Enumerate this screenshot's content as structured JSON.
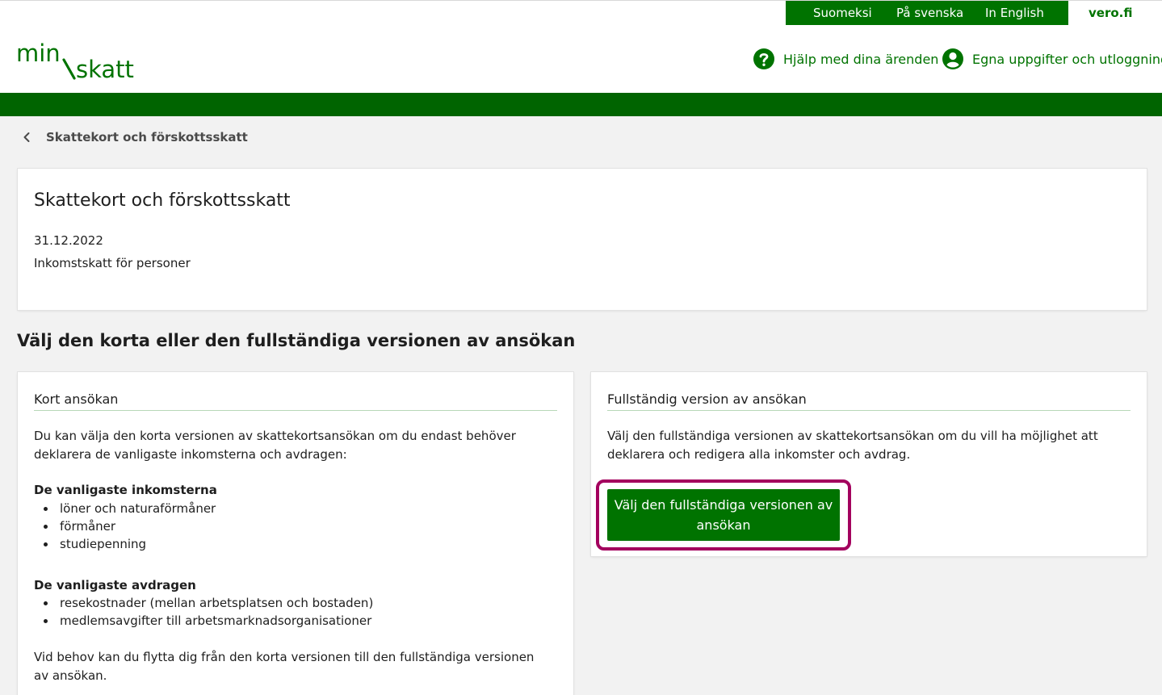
{
  "header": {
    "languages": [
      "Suomeksi",
      "På svenska",
      "In English"
    ],
    "vero_link": "vero.fi",
    "logo_text": "min/skatt",
    "help_link": "Hjälp med dina ärenden",
    "profile_link": "Egna uppgifter och utloggning"
  },
  "breadcrumb": {
    "label": "Skattekort och förskottsskatt"
  },
  "main_card": {
    "title": "Skattekort och förskottsskatt",
    "date": "31.12.2022",
    "type": "Inkomstskatt för personer"
  },
  "section_heading": "Välj den korta eller den fullständiga versionen av ansökan",
  "short_card": {
    "heading": "Kort ansökan",
    "intro": "Du kan välja den korta versionen av skattekortsansökan om du endast behöver deklarera de vanligaste inkomsterna och avdragen:",
    "income_heading": "De vanligaste inkomsterna",
    "income_items": [
      "löner och naturaförmåner",
      "förmåner",
      "studiepenning"
    ],
    "deduction_heading": "De vanligaste avdragen",
    "deduction_items": [
      "resekostnader (mellan arbetsplatsen och bostaden)",
      "medlemsavgifter till arbetsmarknadsorganisationer"
    ],
    "outro": "Vid behov kan du flytta dig från den korta versionen till den fullständiga versionen av ansökan."
  },
  "full_card": {
    "heading": "Fullständig version av ansökan",
    "intro": "Välj den fullständiga versionen av skattekortsansökan om du vill ha möjlighet att deklarera och redigera alla inkomster och avdrag.",
    "button_label": "Välj den fullständiga versionen av ansökan"
  },
  "colors": {
    "brand_green": "#007300",
    "band_green": "#006400",
    "focus_ring": "#a3005e"
  }
}
